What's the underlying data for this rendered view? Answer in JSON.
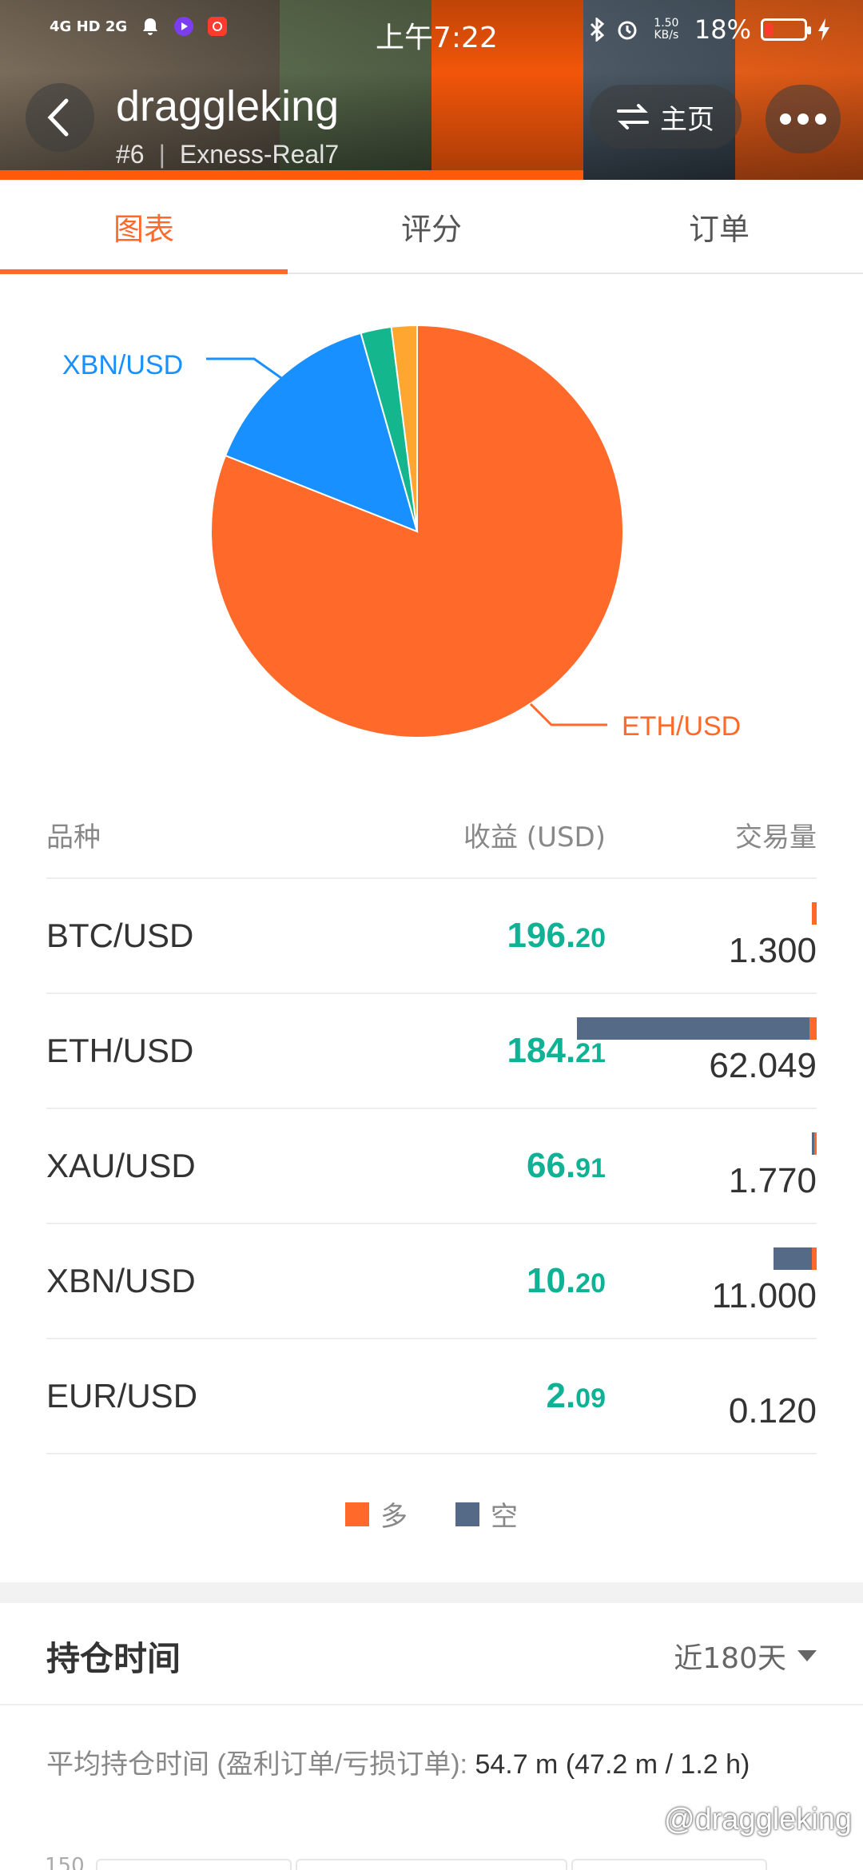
{
  "status_bar": {
    "network": "4G HD 2G",
    "time": "上午7:22",
    "speed": "1.50 KB/s",
    "battery": "18%",
    "battery_level": 0.18
  },
  "header": {
    "username": "draggleking",
    "rank": "#6",
    "account": "Exness-Real7",
    "home_label": "主页"
  },
  "tabs": [
    {
      "label": "图表",
      "active": true
    },
    {
      "label": "评分",
      "active": false
    },
    {
      "label": "订单",
      "active": false
    }
  ],
  "chart_data": {
    "type": "pie",
    "labels": [
      "ETH/USD",
      "XBN/USD",
      "XAU/USD",
      "BTC/USD"
    ],
    "values": [
      81.0,
      14.6,
      2.4,
      2.0
    ],
    "colors": [
      "#ff6a2b",
      "#1890ff",
      "#13b68d",
      "#ffa630"
    ],
    "callouts": [
      "XBN/USD",
      "ETH/USD"
    ]
  },
  "table": {
    "headers": [
      "品种",
      "收益 (USD)",
      "交易量"
    ],
    "rows": [
      {
        "symbol": "BTC/USD",
        "profit_int": "196.",
        "profit_dec": "20",
        "volume": "1.300",
        "short_frac": 0.0,
        "long_frac": 0.02
      },
      {
        "symbol": "ETH/USD",
        "profit_int": "184.",
        "profit_dec": "21",
        "volume": "62.049",
        "short_frac": 0.97,
        "long_frac": 0.03
      },
      {
        "symbol": "XAU/USD",
        "profit_int": "66.",
        "profit_dec": "91",
        "volume": "1.770",
        "short_frac": 0.01,
        "long_frac": 0.01
      },
      {
        "symbol": "XBN/USD",
        "profit_int": "10.",
        "profit_dec": "20",
        "volume": "11.000",
        "short_frac": 0.16,
        "long_frac": 0.02
      },
      {
        "symbol": "EUR/USD",
        "profit_int": "2.",
        "profit_dec": "09",
        "volume": "0.120",
        "short_frac": 0.0,
        "long_frac": 0.0
      }
    ]
  },
  "legend": {
    "long": "多",
    "short": "空",
    "long_color": "#ff6a2b",
    "short_color": "#546a87"
  },
  "holding": {
    "title": "持仓时间",
    "period": "近180天",
    "avg_label": "平均持仓时间 (盈利订单/亏损订单):",
    "avg_value": "54.7 m (47.2 m / 1.2 h)",
    "axis_stub": "150"
  },
  "watermark": "@draggleking"
}
